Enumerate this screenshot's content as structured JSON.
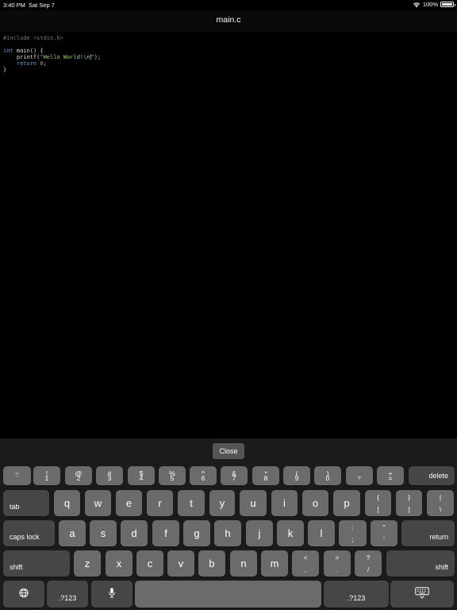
{
  "status_bar": {
    "time": "3:40 PM",
    "date": "Sat Sep 7",
    "battery": "100%",
    "battery_level": 1.0
  },
  "header": {
    "title": "main.c"
  },
  "editor": {
    "lines": [
      [
        {
          "t": "#include <stdio.h>",
          "c": "pre"
        }
      ],
      [],
      [
        {
          "t": "int",
          "c": "kw"
        },
        {
          "t": " main() {",
          "c": "plain"
        }
      ],
      [
        {
          "t": "    printf(",
          "c": "plain"
        },
        {
          "t": "\"Hello World!\\n",
          "c": "str"
        },
        {
          "t": "|",
          "c": "caret"
        },
        {
          "t": "\"",
          "c": "str"
        },
        {
          "t": ");",
          "c": "plain"
        }
      ],
      [
        {
          "t": "    return",
          "c": "kw"
        },
        {
          "t": " ",
          "c": "plain"
        },
        {
          "t": "0",
          "c": "num"
        },
        {
          "t": ";",
          "c": "plain"
        }
      ],
      [
        {
          "t": "}",
          "c": "plain"
        }
      ]
    ]
  },
  "keyboard": {
    "close_label": "Close",
    "rows": [
      [
        {
          "id": "tilde",
          "top": "~",
          "bot": "`"
        },
        {
          "id": "1",
          "top": "!",
          "bot": "1"
        },
        {
          "id": "2",
          "top": "@",
          "bot": "2"
        },
        {
          "id": "3",
          "top": "#",
          "bot": "3"
        },
        {
          "id": "4",
          "top": "$",
          "bot": "4"
        },
        {
          "id": "5",
          "top": "%",
          "bot": "5"
        },
        {
          "id": "6",
          "top": "^",
          "bot": "6"
        },
        {
          "id": "7",
          "top": "&",
          "bot": "7"
        },
        {
          "id": "8",
          "top": "*",
          "bot": "8"
        },
        {
          "id": "9",
          "top": "(",
          "bot": "9"
        },
        {
          "id": "0",
          "top": ")",
          "bot": "0"
        },
        {
          "id": "minus",
          "top": "_",
          "bot": "-"
        },
        {
          "id": "equals",
          "top": "+",
          "bot": "="
        },
        {
          "id": "delete",
          "label": "delete",
          "align": "r",
          "dark": true
        }
      ],
      [
        {
          "id": "tab",
          "label": "tab",
          "align": "l",
          "dark": true
        },
        {
          "id": "q",
          "main": "q"
        },
        {
          "id": "w",
          "main": "w"
        },
        {
          "id": "e",
          "main": "e"
        },
        {
          "id": "r",
          "main": "r"
        },
        {
          "id": "t",
          "main": "t"
        },
        {
          "id": "y",
          "main": "y"
        },
        {
          "id": "u",
          "main": "u"
        },
        {
          "id": "i",
          "main": "i"
        },
        {
          "id": "o",
          "main": "o"
        },
        {
          "id": "p",
          "main": "p"
        },
        {
          "id": "lbracket",
          "top": "{",
          "bot": "["
        },
        {
          "id": "rbracket",
          "top": "}",
          "bot": "]"
        },
        {
          "id": "backslash",
          "top": "|",
          "bot": "\\"
        }
      ],
      [
        {
          "id": "caps-lock",
          "label": "caps lock",
          "align": "l",
          "dark": true
        },
        {
          "id": "a",
          "main": "a"
        },
        {
          "id": "s",
          "main": "s"
        },
        {
          "id": "d",
          "main": "d"
        },
        {
          "id": "f",
          "main": "f"
        },
        {
          "id": "g",
          "main": "g"
        },
        {
          "id": "h",
          "main": "h"
        },
        {
          "id": "j",
          "main": "j"
        },
        {
          "id": "k",
          "main": "k"
        },
        {
          "id": "l",
          "main": "l"
        },
        {
          "id": "semicolon",
          "top": ":",
          "bot": ";"
        },
        {
          "id": "quote",
          "top": "\"",
          "bot": "'"
        },
        {
          "id": "return",
          "label": "return",
          "align": "r",
          "dark": true
        }
      ],
      [
        {
          "id": "shift-left",
          "label": "shift",
          "align": "l",
          "dark": true
        },
        {
          "id": "z",
          "main": "z"
        },
        {
          "id": "x",
          "main": "x"
        },
        {
          "id": "c",
          "main": "c"
        },
        {
          "id": "v",
          "main": "v"
        },
        {
          "id": "b",
          "main": "b"
        },
        {
          "id": "n",
          "main": "n"
        },
        {
          "id": "m",
          "main": "m"
        },
        {
          "id": "comma",
          "top": "<",
          "bot": ","
        },
        {
          "id": "period",
          "top": ">",
          "bot": "."
        },
        {
          "id": "slash",
          "top": "?",
          "bot": "/"
        },
        {
          "id": "shift-right",
          "label": "shift",
          "align": "r",
          "dark": true
        }
      ],
      [
        {
          "id": "globe",
          "icon": "globe-icon",
          "dark": true
        },
        {
          "id": "numbers-left",
          "label": ".?123",
          "align": "c",
          "dark": true
        },
        {
          "id": "dictation",
          "icon": "microphone-icon",
          "dark": true
        },
        {
          "id": "space",
          "main": ""
        },
        {
          "id": "numbers-right",
          "label": ".?123",
          "align": "c",
          "dark": true
        },
        {
          "id": "hide-keyboard",
          "icon": "keyboard-hide-icon",
          "dark": true
        }
      ]
    ]
  }
}
